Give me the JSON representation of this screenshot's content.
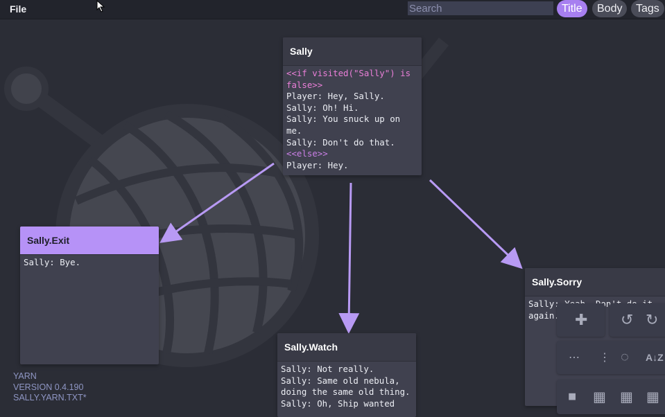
{
  "app": {
    "menu_file": "File",
    "search_placeholder": "Search",
    "filters": [
      "Title",
      "Body",
      "Tags"
    ],
    "active_filter": "Title"
  },
  "nodes": {
    "sally": {
      "title": "Sally",
      "lines": [
        {
          "text": "<<if visited(\"Sally\") is false>>",
          "kind": "command"
        },
        {
          "text": "Player: Hey, Sally.",
          "kind": "text"
        },
        {
          "text": "Sally: Oh! Hi.",
          "kind": "text"
        },
        {
          "text": "Sally: You snuck up on me.",
          "kind": "text"
        },
        {
          "text": "Sally: Don't do that.",
          "kind": "text"
        },
        {
          "text": "<<else>>",
          "kind": "command"
        },
        {
          "text": "Player: Hey.",
          "kind": "text"
        }
      ]
    },
    "sally_exit": {
      "title": "Sally.Exit",
      "body": "Sally: Bye."
    },
    "sally_watch": {
      "title": "Sally.Watch",
      "body": "Sally: Not really.\nSally: Same old nebula, doing the same old thing.\nSally: Oh, Ship wanted"
    },
    "sally_sorry": {
      "title": "Sally.Sorry",
      "body": "Sally: Yeah. Don't do it again."
    }
  },
  "footer": {
    "app_name": "YARN",
    "version": "VERSION 0.4.190",
    "file": "SALLY.YARN.TXT*"
  },
  "colors": {
    "accent": "#a77ff0",
    "background": "#2b2d36",
    "node": "#40414f",
    "arrow": "#b89af4"
  },
  "toolbar_icons": [
    "add-icon",
    "undo-icon",
    "redo-icon",
    "more-horizontal-icon",
    "more-vertical-icon",
    "circle-spinner-icon",
    "sort-az-icon",
    "grid-1-icon",
    "grid-2-icon",
    "grid-3-icon",
    "grid-4-icon"
  ]
}
